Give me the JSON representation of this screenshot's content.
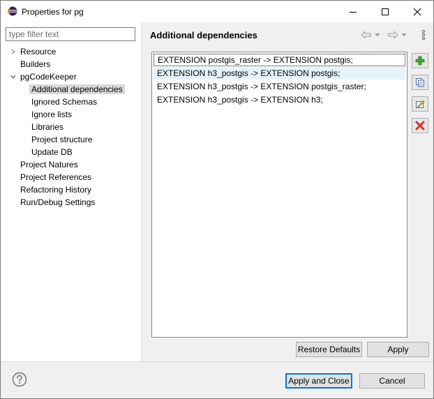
{
  "window": {
    "title": "Properties for pg"
  },
  "filter": {
    "placeholder": "type filter text",
    "value": ""
  },
  "tree": {
    "items": [
      {
        "label": "Resource",
        "expandable": true,
        "expanded": false
      },
      {
        "label": "Builders"
      },
      {
        "label": "pgCodeKeeper",
        "expandable": true,
        "expanded": true
      },
      {
        "label": "Additional dependencies",
        "selected": true
      },
      {
        "label": "Ignored Schemas"
      },
      {
        "label": "Ignore lists"
      },
      {
        "label": "Libraries"
      },
      {
        "label": "Project structure"
      },
      {
        "label": "Update DB"
      },
      {
        "label": "Project Natures"
      },
      {
        "label": "Project References"
      },
      {
        "label": "Refactoring History"
      },
      {
        "label": "Run/Debug Settings"
      }
    ]
  },
  "page": {
    "title": "Additional dependencies"
  },
  "dependencies": [
    {
      "text": "EXTENSION postgis_raster -> EXTENSION postgis;",
      "focused": true
    },
    {
      "text": "EXTENSION h3_postgis -> EXTENSION postgis;",
      "selected": true
    },
    {
      "text": "EXTENSION h3_postgis -> EXTENSION postgis_raster;"
    },
    {
      "text": "EXTENSION h3_postgis -> EXTENSION h3;"
    }
  ],
  "side_buttons": [
    {
      "icon": "add-icon"
    },
    {
      "icon": "copy-icon"
    },
    {
      "icon": "edit-icon"
    },
    {
      "icon": "delete-icon"
    }
  ],
  "buttons": {
    "restore_defaults": "Restore Defaults",
    "apply": "Apply",
    "apply_and_close": "Apply and Close",
    "cancel": "Cancel"
  },
  "colors": {
    "selection_highlight": "#e5f3fb",
    "default_button_border": "#0078d7",
    "add_icon": "#3fa535",
    "delete_icon": "#d9302c"
  }
}
